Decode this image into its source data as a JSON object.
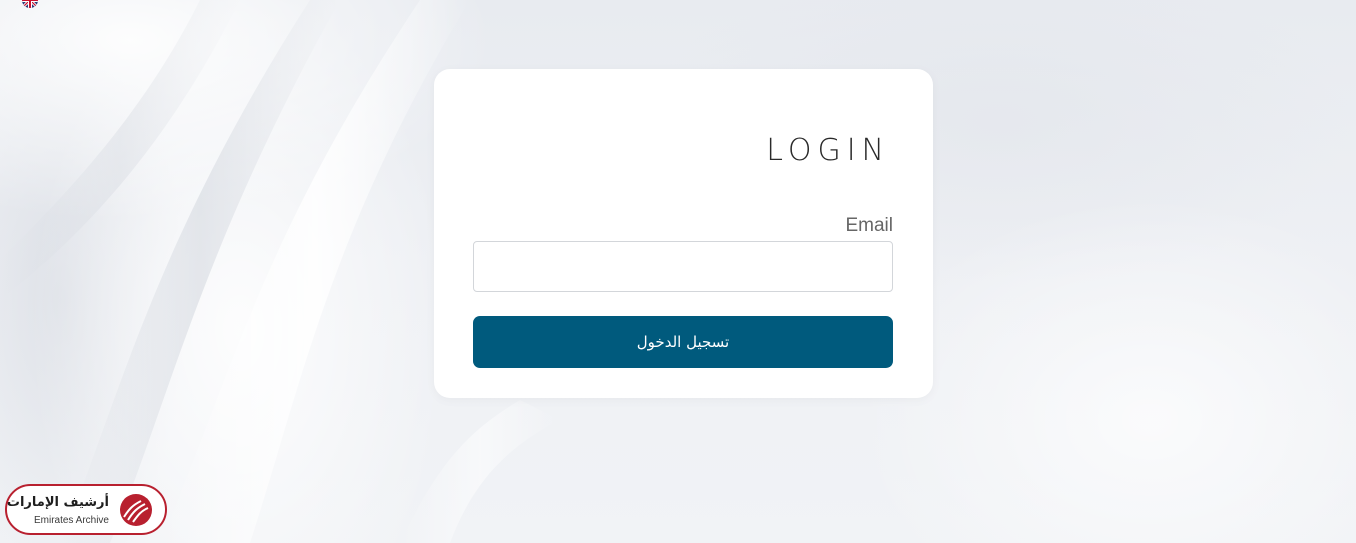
{
  "login": {
    "title": "LOGIN",
    "email_label": "Email",
    "email_value": "",
    "submit_label": "تسجيل الدخول"
  },
  "brand": {
    "name_ar": "أرشيف الإمارات",
    "name_en": "Emirates Archive",
    "accent_color": "#b8202f"
  },
  "colors": {
    "button": "#005a7d",
    "card": "#ffffff",
    "background": "#eef0f4"
  },
  "icons": {
    "language": "uk-flag-icon",
    "brand": "emirates-archive-logo-mark"
  }
}
